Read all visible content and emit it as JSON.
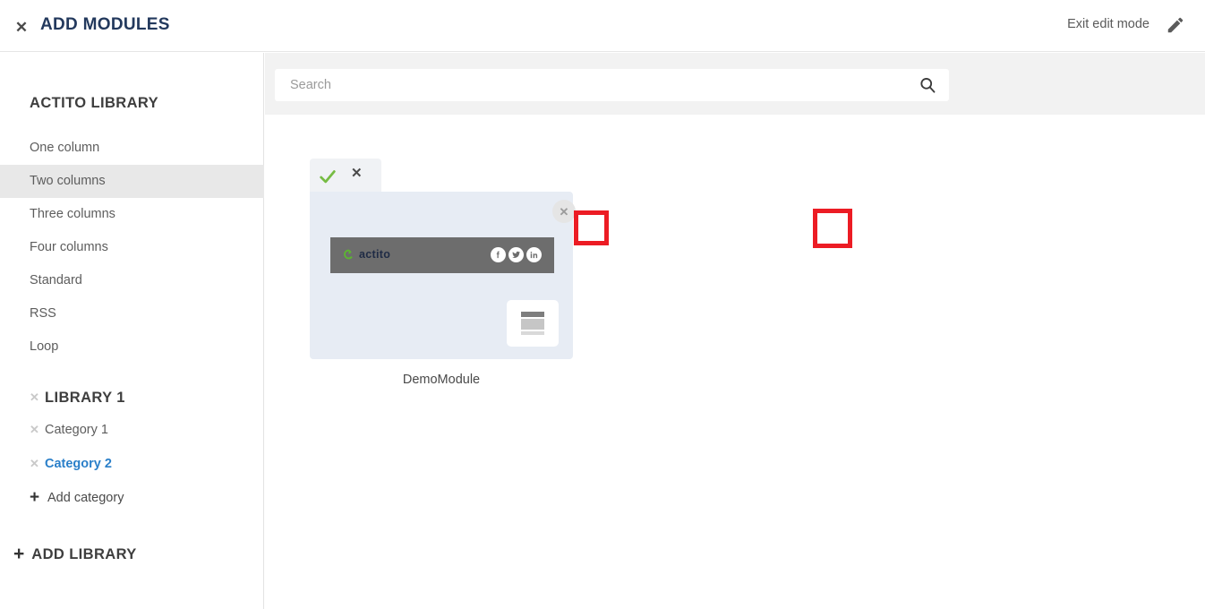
{
  "header": {
    "close_icon": "close-x-icon",
    "title": "ADD MODULES",
    "exit_edit_label": "Exit edit mode",
    "edit_icon": "pencil-icon"
  },
  "sidebar": {
    "library_title": "ACTITO LIBRARY",
    "items": [
      {
        "label": "One column",
        "active": false
      },
      {
        "label": "Two columns",
        "active": true
      },
      {
        "label": "Three columns",
        "active": false
      },
      {
        "label": "Four columns",
        "active": false
      },
      {
        "label": "Standard",
        "active": false
      },
      {
        "label": "RSS",
        "active": false
      },
      {
        "label": "Loop",
        "active": false
      }
    ],
    "library1": {
      "delete_icon": "x-delete-icon",
      "title": "LIBRARY 1",
      "categories": [
        {
          "delete_icon": "x-delete-icon",
          "label": "Category 1",
          "active": false
        },
        {
          "delete_icon": "x-delete-icon",
          "label": "Category 2",
          "active": true
        }
      ],
      "add_category": {
        "icon": "plus-icon",
        "label": "Add category"
      }
    },
    "add_library": {
      "icon": "plus-icon",
      "label": "ADD LIBRARY"
    }
  },
  "search": {
    "value": "",
    "placeholder": "Search",
    "icon": "search-icon"
  },
  "module": {
    "toolbar": {
      "confirm_icon": "green-check-icon",
      "cancel_icon": "x-icon"
    },
    "close_icon": "circle-close-icon",
    "banner": {
      "logo_mark": "actito-logo-icon",
      "logo_text": "actito",
      "socials": [
        {
          "icon": "facebook-icon"
        },
        {
          "icon": "twitter-icon"
        },
        {
          "icon": "linkedin-icon"
        }
      ]
    },
    "placeholder_icon": "content-block-icon",
    "name": "DemoModule"
  },
  "colors": {
    "accent_blue": "#2a7fc9",
    "title_navy": "#23395d",
    "check_green": "#76bc43",
    "annotation_red": "#ec1c24",
    "card_bg": "#e7ecf4",
    "banner_gray": "#6d6d6d"
  }
}
